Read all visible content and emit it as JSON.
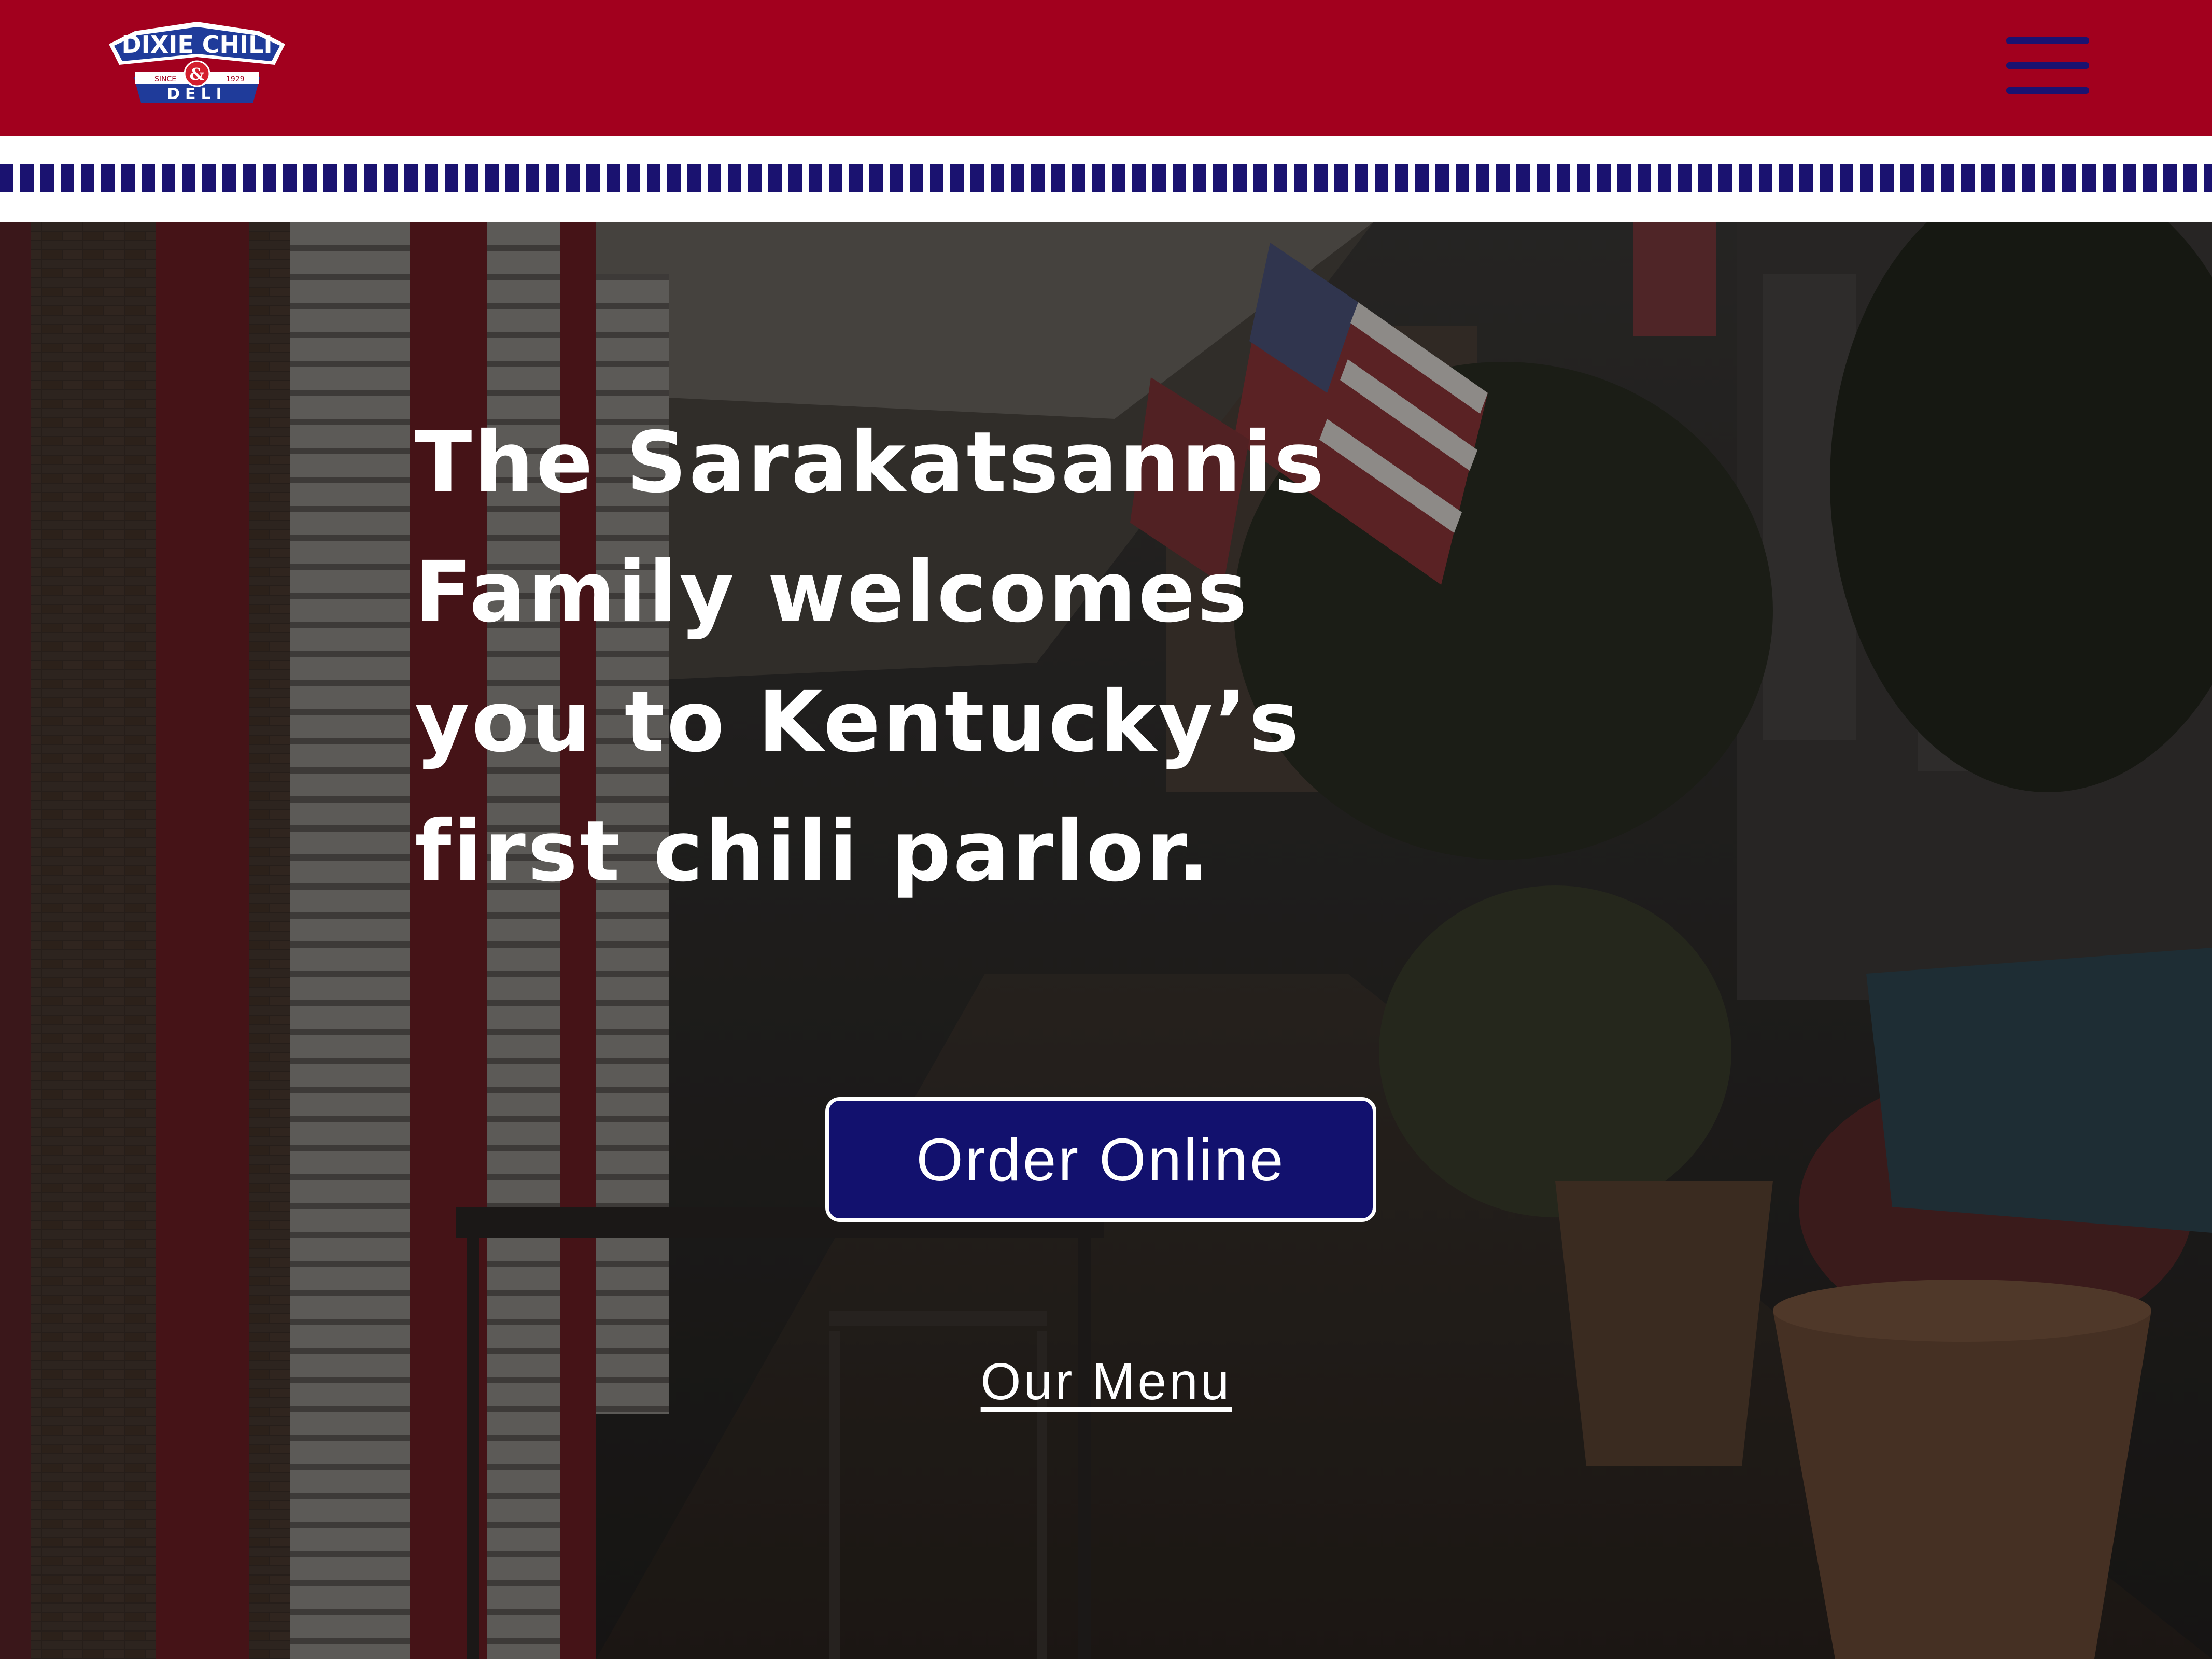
{
  "brand": {
    "logo_top": "DIXIE CHILI",
    "logo_bottom": "DELI",
    "logo_since": "SINCE",
    "logo_year": "1929",
    "logo_amp": "&"
  },
  "header": {
    "menu_icon": "hamburger-menu-icon",
    "background_color": "#a2001e",
    "accent_color": "#1a1270"
  },
  "hero": {
    "title_lines": [
      "The Sarakatsannis",
      "Family welcomes",
      "you to Kentucky’s",
      "first chili parlor."
    ],
    "order_button": "Order Online",
    "menu_link": "Our Menu"
  }
}
